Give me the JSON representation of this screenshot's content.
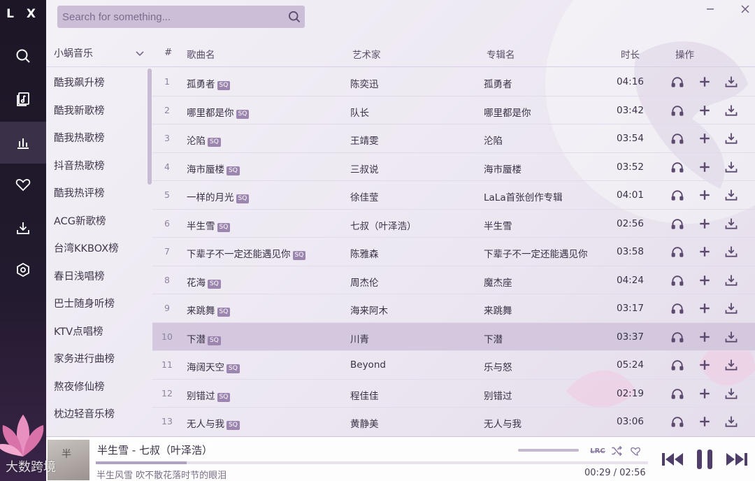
{
  "app": {
    "logo": "L X"
  },
  "search": {
    "placeholder": "Search for something..."
  },
  "source": {
    "selected": "小蜗音乐",
    "items": [
      "酷我飙升榜",
      "酷我新歌榜",
      "酷我热歌榜",
      "抖音热歌榜",
      "酷我热评榜",
      "ACG新歌榜",
      "台湾KKBOX榜",
      "春日浅唱榜",
      "巴士随身听榜",
      "KTV点唱榜",
      "家务进行曲榜",
      "熬夜修仙榜",
      "枕边轻音乐榜"
    ]
  },
  "table": {
    "headers": {
      "num": "#",
      "name": "歌曲名",
      "artist": "艺术家",
      "album": "专辑名",
      "duration": "时长",
      "actions": "操作"
    },
    "quality_tag": "SQ",
    "selected_index": 9,
    "rows": [
      {
        "num": "1",
        "name": "孤勇者",
        "artist": "陈奕迅",
        "album": "孤勇者",
        "duration": "04:16"
      },
      {
        "num": "2",
        "name": "哪里都是你",
        "artist": "队长",
        "album": "哪里都是你",
        "duration": "03:42"
      },
      {
        "num": "3",
        "name": "沦陷",
        "artist": "王靖雯",
        "album": "沦陷",
        "duration": "03:54"
      },
      {
        "num": "4",
        "name": "海市蜃楼",
        "artist": "三叔说",
        "album": "海市蜃楼",
        "duration": "03:52"
      },
      {
        "num": "5",
        "name": "一样的月光",
        "artist": "徐佳莹",
        "album": "LaLa首张创作专辑",
        "duration": "04:01"
      },
      {
        "num": "6",
        "name": "半生雪",
        "artist": "七叔（叶泽浩）",
        "album": "半生雪",
        "duration": "02:56"
      },
      {
        "num": "7",
        "name": "下辈子不一定还能遇见你",
        "artist": "陈雅森",
        "album": "下辈子不一定还能遇见你",
        "duration": "03:58"
      },
      {
        "num": "8",
        "name": "花海",
        "artist": "周杰伦",
        "album": "魔杰座",
        "duration": "04:24"
      },
      {
        "num": "9",
        "name": "来跳舞",
        "artist": "海来阿木",
        "album": "来跳舞",
        "duration": "03:17"
      },
      {
        "num": "10",
        "name": "下潜",
        "artist": "川青",
        "album": "下潜",
        "duration": "03:37"
      },
      {
        "num": "11",
        "name": "海阔天空",
        "artist": "Beyond",
        "album": "乐与怒",
        "duration": "05:24"
      },
      {
        "num": "12",
        "name": "别错过",
        "artist": "程佳佳",
        "album": "别错过",
        "duration": "02:19"
      },
      {
        "num": "13",
        "name": "无人与我",
        "artist": "黄静美",
        "album": "无人与我",
        "duration": "03:06"
      }
    ]
  },
  "player": {
    "cover_text": "半",
    "title": "半生雪 - 七叔（叶泽浩）",
    "lyric": "半生风雪 吹不散花落时节的眼泪",
    "current_time": "00:29",
    "separator": "/",
    "total_time": "02:56",
    "progress": 0.165,
    "lrc_label": "LRC"
  },
  "watermark": "大数跨境",
  "colors": {
    "accent": "#5b4a6e",
    "rail": "#1c1626",
    "selected_row": "#d4c8df"
  }
}
